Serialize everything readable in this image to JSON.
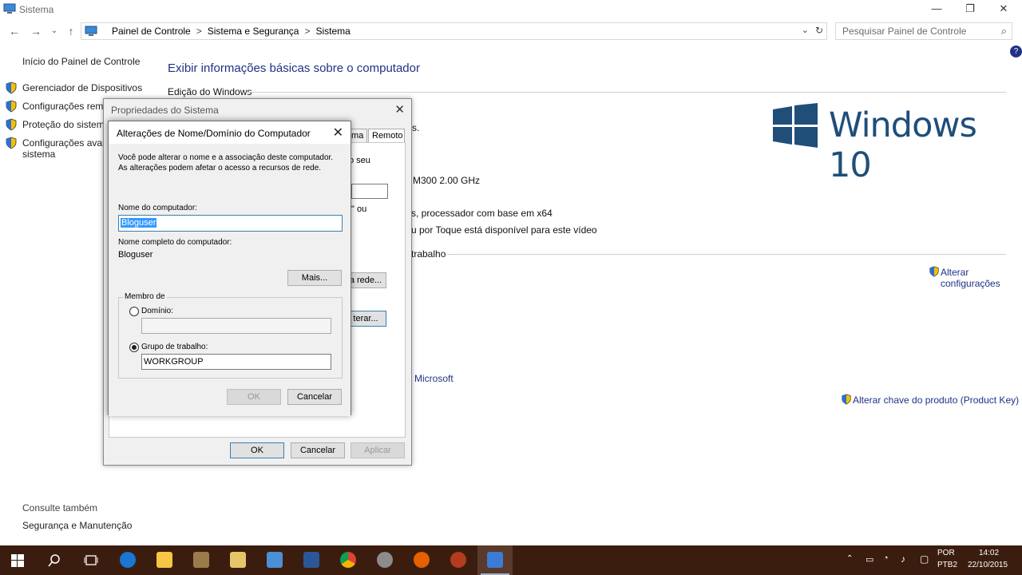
{
  "window": {
    "title": "Sistema",
    "minimize": "—",
    "restore": "❐",
    "close": "✕"
  },
  "nav": {
    "back": "←",
    "forward": "→",
    "history": "⌄",
    "up": "↑",
    "breadcrumbs": [
      "Painel de Controle",
      "Sistema e Segurança",
      "Sistema"
    ],
    "separator": ">",
    "dropdown": "⌄",
    "refresh": "↻",
    "search_placeholder": "Pesquisar Painel de Controle",
    "search_icon": "⌕"
  },
  "leftnav": {
    "home": "Início do Painel de Controle",
    "items": [
      "Gerenciador de Dispositivos",
      "Configurações remotas",
      "Proteção do sistema",
      "Configurações avançadas do sistema"
    ],
    "item_lines": [
      [
        "Gerenciador de Dispositivos"
      ],
      [
        "Configurações remo"
      ],
      [
        "Proteção do sistema"
      ],
      [
        "Configurações avan",
        "sistema"
      ]
    ],
    "see_also": "Consulte também",
    "security_link": "Segurança e Manutenção"
  },
  "main": {
    "heading": "Exibir informações básicas sobre o computador",
    "edition_label": "Edição do Windows",
    "partial_texts": {
      "s_dot": "s.",
      "cpu": "M300   2.00 GHz",
      "processor": "s, processador com base em x64",
      "touch": "u por Toque está disponível para este vídeo",
      "workgroup_section": "trabalho",
      "microsoft": "Microsoft"
    },
    "change_settings": [
      "Alterar",
      "configurações"
    ],
    "product_key": "Alterar chave do produto (Product Key)",
    "windows_brand": "Windows 10",
    "brand_color": "#1f4e79"
  },
  "sysprops": {
    "title": "Propriedades do Sistema",
    "close": "✕",
    "tabs": [
      "ma",
      "Remoto"
    ],
    "partial_texts": {
      "seu": "o seu",
      "ou": "\" ou"
    },
    "buttons": {
      "network": "a rede...",
      "change": "terar...",
      "ok": "OK",
      "cancel": "Cancelar",
      "apply": "Aplicar"
    }
  },
  "rename_dialog": {
    "title": "Alterações de Nome/Domínio do Computador",
    "close": "✕",
    "intro": [
      "Você pode alterar o nome e a associação deste computador.",
      "As alterações podem afetar o acesso a recursos de rede."
    ],
    "computer_name_label": "Nome do computador:",
    "computer_name_value": "Bloguser",
    "full_name_label": "Nome completo do computador:",
    "full_name_value": "Bloguser",
    "more_button": "Mais...",
    "member_of_label": "Membro de",
    "domain_label": "Domínio:",
    "domain_value": "",
    "workgroup_label": "Grupo de trabalho:",
    "workgroup_value": "WORKGROUP",
    "selected_membership": "workgroup",
    "ok_button": "OK",
    "cancel_button": "Cancelar"
  },
  "help_icon": "?",
  "taskbar": {
    "color": "#3b1d0f",
    "apps": [
      "start-icon",
      "search-icon",
      "task-view-icon",
      "edge-icon",
      "file-explorer-icon",
      "media-icon",
      "mail-icon",
      "network-app-icon",
      "word-icon",
      "chrome-icon",
      "settings-app-icon",
      "firefox-icon",
      "film-icon",
      "system-app-icon"
    ],
    "tray": {
      "language_top": "POR",
      "language_bottom": "PTB2",
      "time": "14:02",
      "date": "22/10/2015"
    }
  }
}
